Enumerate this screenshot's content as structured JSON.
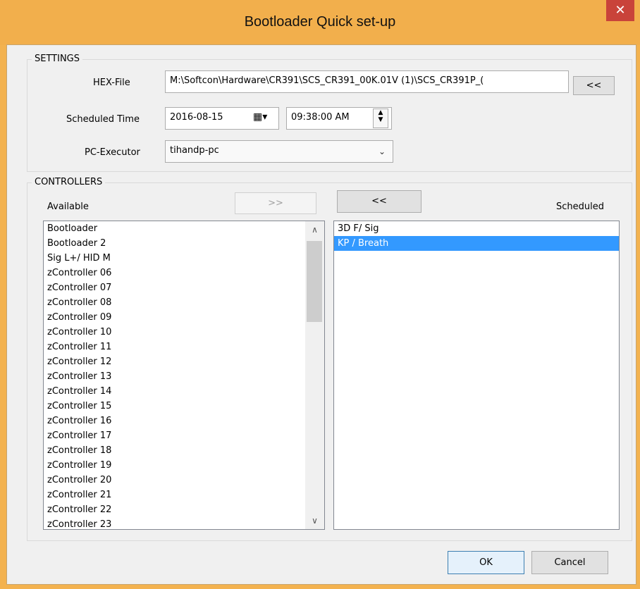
{
  "window": {
    "title": "Bootloader Quick set-up",
    "close_glyph": "✕"
  },
  "settings": {
    "group_label": "SETTINGS",
    "hex_label": "HEX-File",
    "hex_value": "M:\\Softcon\\Hardware\\CR391\\SCS_CR391_00K.01V (1)\\SCS_CR391P_(",
    "hex_browse": "<<",
    "time_label": "Scheduled Time",
    "date_value": "2016-08-15",
    "time_value": "09:38:00 AM",
    "executor_label": "PC-Executor",
    "executor_value": "tihandp-pc"
  },
  "controllers": {
    "group_label": "CONTROLLERS",
    "available_label": "Available",
    "scheduled_label": "Scheduled",
    "add_button": ">>",
    "remove_button": "<<",
    "available": [
      "Bootloader",
      "Bootloader 2",
      "Sig L+/ HID M",
      "zController 06",
      "zController 07",
      "zController 08",
      "zController 09",
      "zController 10",
      "zController 11",
      "zController 12",
      "zController 13",
      "zController 14",
      "zController 15",
      "zController 16",
      "zController 17",
      "zController 18",
      "zController 19",
      "zController 20",
      "zController 21",
      "zController 22",
      "zController 23"
    ],
    "scheduled": [
      "3D F/ Sig",
      "KP / Breath"
    ]
  },
  "footer": {
    "ok": "OK",
    "cancel": "Cancel"
  }
}
